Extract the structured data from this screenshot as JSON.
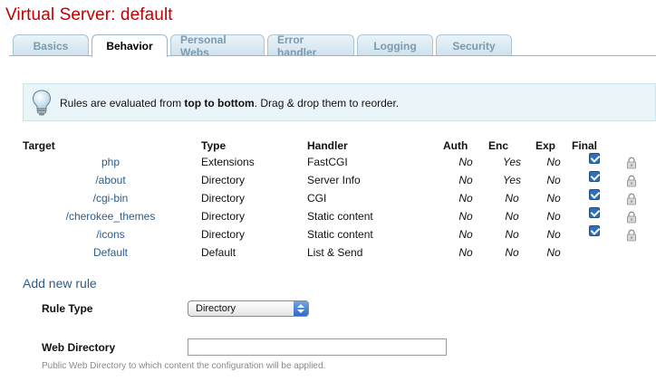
{
  "header": {
    "title": "Virtual Server: default"
  },
  "tabs": [
    {
      "label": "Basics",
      "active": false,
      "width": 84
    },
    {
      "label": "Behavior",
      "active": true,
      "width": 84
    },
    {
      "label": "Personal Webs",
      "active": false,
      "width": 104
    },
    {
      "label": "Error handler",
      "active": false,
      "width": 96
    },
    {
      "label": "Logging",
      "active": false,
      "width": 84
    },
    {
      "label": "Security",
      "active": false,
      "width": 84
    }
  ],
  "info": {
    "text_before": "Rules are evaluated from ",
    "text_bold": "top to bottom",
    "text_after": ". Drag & drop them to reorder."
  },
  "rules": {
    "columns": {
      "target": "Target",
      "type": "Type",
      "handler": "Handler",
      "auth": "Auth",
      "enc": "Enc",
      "exp": "Exp",
      "final": "Final"
    },
    "rows": [
      {
        "target": "php",
        "type": "Extensions",
        "handler": "FastCGI",
        "auth": "No",
        "enc": "Yes",
        "exp": "No",
        "final": true,
        "lock": true
      },
      {
        "target": "/about",
        "type": "Directory",
        "handler": "Server Info",
        "auth": "No",
        "enc": "Yes",
        "exp": "No",
        "final": true,
        "lock": true
      },
      {
        "target": "/cgi-bin",
        "type": "Directory",
        "handler": "CGI",
        "auth": "No",
        "enc": "No",
        "exp": "No",
        "final": true,
        "lock": true
      },
      {
        "target": "/cherokee_themes",
        "type": "Directory",
        "handler": "Static content",
        "auth": "No",
        "enc": "No",
        "exp": "No",
        "final": true,
        "lock": true
      },
      {
        "target": "/icons",
        "type": "Directory",
        "handler": "Static content",
        "auth": "No",
        "enc": "No",
        "exp": "No",
        "final": true,
        "lock": true
      },
      {
        "target": "Default",
        "type": "Default",
        "handler": "List & Send",
        "auth": "No",
        "enc": "No",
        "exp": "No",
        "final": false,
        "lock": false
      }
    ]
  },
  "add_rule": {
    "title": "Add new rule",
    "rule_type_label": "Rule Type",
    "rule_type_value": "Directory",
    "web_directory_label": "Web Directory",
    "web_directory_value": "",
    "web_directory_help": "Public Web Directory to which content the configuration will be applied."
  },
  "colors": {
    "title": "#c00000",
    "link": "#2b5c8c",
    "tab_border": "#a9c5d6",
    "info_bg": "#eaf5f9",
    "checkbox": "#2f6fb8"
  },
  "icons": {
    "info": "lightbulb-icon",
    "lock": "lock-icon",
    "checkbox": "checkbox-checked-icon"
  }
}
